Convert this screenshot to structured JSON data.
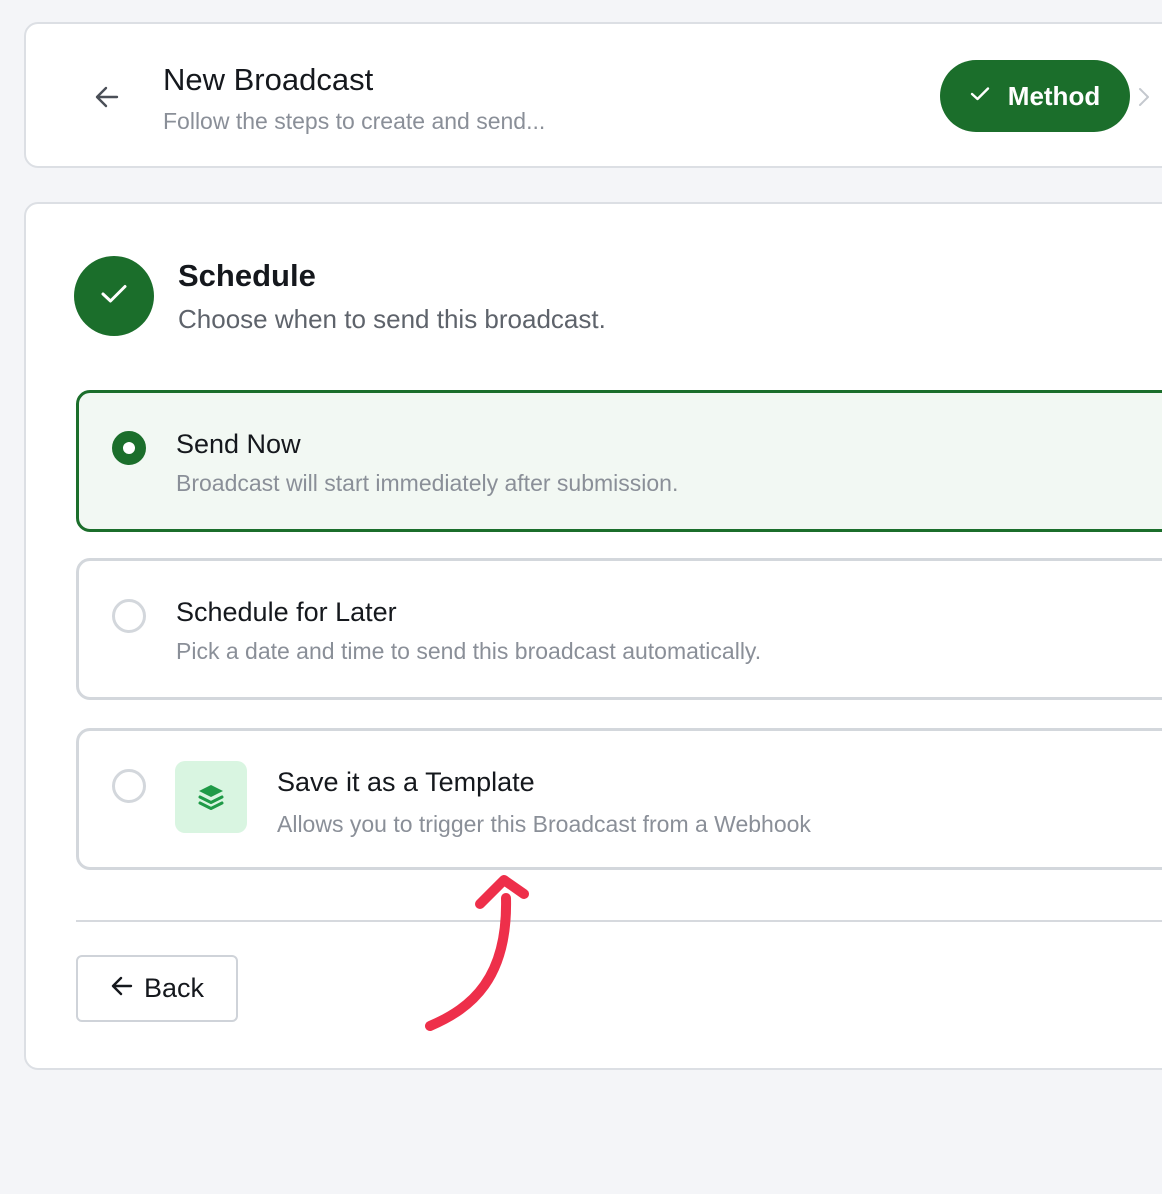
{
  "header": {
    "title": "New Broadcast",
    "subtitle": "Follow the steps to create and send...",
    "back_icon": "arrow-left-icon",
    "step_pill": {
      "label": "Method",
      "icon": "check-icon",
      "color": "#1b6e2b"
    },
    "next_icon": "chevron-right-icon"
  },
  "schedule": {
    "title": "Schedule",
    "subtitle": "Choose when to send this broadcast.",
    "status_icon": "check-icon",
    "options": [
      {
        "title": "Send Now",
        "description": "Broadcast will start immediately after submission.",
        "selected": true
      },
      {
        "title": "Schedule for Later",
        "description": "Pick a date and time to send this broadcast automatically.",
        "selected": false
      },
      {
        "title": "Save it as a Template",
        "description": "Allows you to trigger this Broadcast from a Webhook",
        "selected": false,
        "icon": "layers-icon"
      }
    ]
  },
  "footer": {
    "back_label": "Back",
    "back_icon": "arrow-left-icon"
  },
  "annotation": {
    "icon": "curved-arrow-icon",
    "color": "#ee2f4a"
  },
  "colors": {
    "accent": "#1b6e2b",
    "selected_bg": "#f2f8f3",
    "template_icon_bg": "#d9f5e1",
    "page_bg": "#f4f5f8"
  }
}
